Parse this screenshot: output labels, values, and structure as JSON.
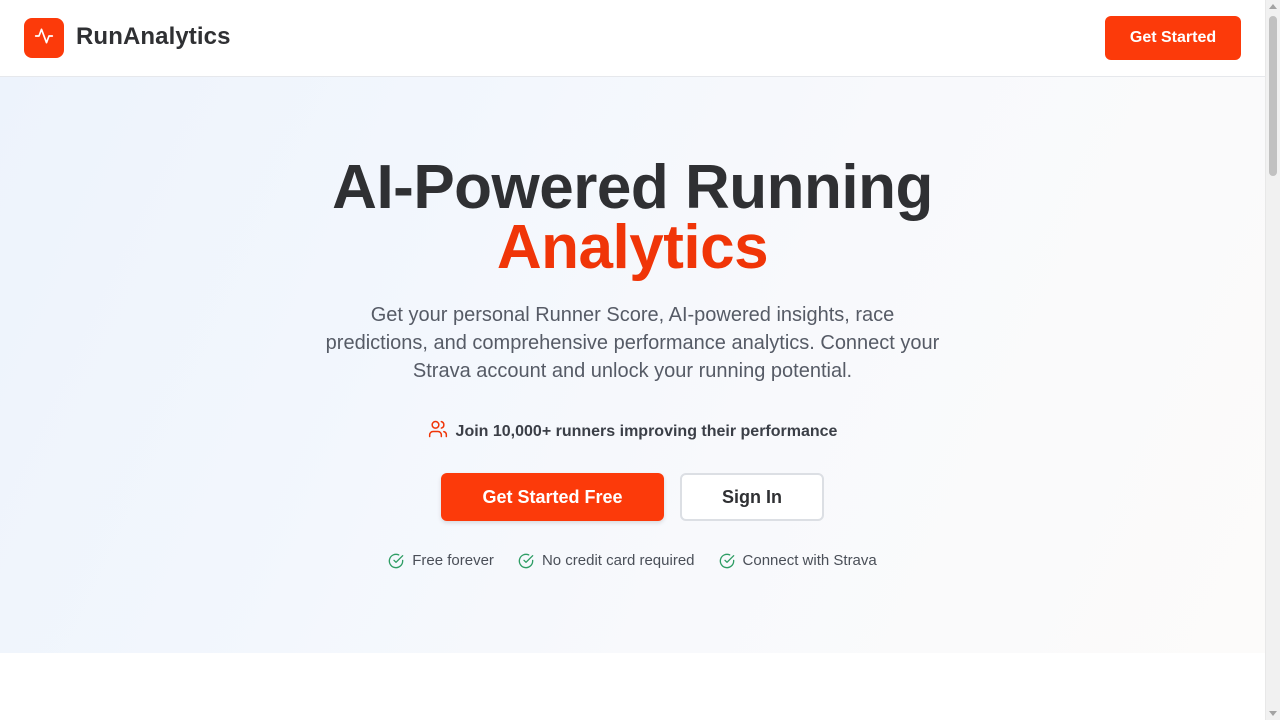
{
  "colors": {
    "brand": "#fc3a0a",
    "title_accent": "#f03508",
    "check_icon": "#2e9d64"
  },
  "header": {
    "brand_name": "RunAnalytics",
    "logo_icon": "activity-icon",
    "cta_label": "Get Started"
  },
  "hero": {
    "title_line1": "AI-Powered Running",
    "title_line2": "Analytics",
    "subtitle": "Get your personal Runner Score, AI-powered insights, race predictions, and comprehensive performance analytics. Connect your Strava account and unlock your running potential.",
    "social_proof": {
      "icon": "users-icon",
      "text": "Join 10,000+ runners improving their performance"
    },
    "primary_button": "Get Started Free",
    "secondary_button": "Sign In",
    "features": [
      {
        "icon": "check-circle-icon",
        "label": "Free forever"
      },
      {
        "icon": "check-circle-icon",
        "label": "No credit card required"
      },
      {
        "icon": "check-circle-icon",
        "label": "Connect with Strava"
      }
    ]
  }
}
